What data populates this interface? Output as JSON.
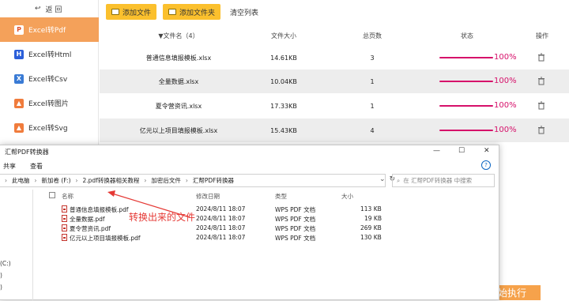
{
  "app": {
    "back_label": "返 回",
    "sidebar": [
      {
        "label": "Excel转Pdf",
        "icon": "pdf-icon",
        "color": "#e0502c",
        "active": true
      },
      {
        "label": "Excel转Html",
        "icon": "html-icon",
        "color": "#2b5fd9",
        "active": false
      },
      {
        "label": "Excel转Csv",
        "icon": "csv-icon",
        "color": "#3a7bd5",
        "active": false
      },
      {
        "label": "Excel转图片",
        "icon": "image-icon",
        "color": "#f07c3c",
        "active": false
      },
      {
        "label": "Excel转Svg",
        "icon": "svg-icon",
        "color": "#f07c3c",
        "active": false
      }
    ],
    "toolbar": {
      "add_file": "添加文件",
      "add_folder": "添加文件夹",
      "clear_list": "清空列表"
    },
    "table": {
      "headers": {
        "name": "▼文件名（4）",
        "size": "文件大小",
        "pages": "总页数",
        "status": "状态",
        "action": "操作"
      },
      "rows": [
        {
          "name": "普通信息填报模板.xlsx",
          "size": "14.61KB",
          "pages": "3",
          "progress": "100%"
        },
        {
          "name": "全量数据.xlsx",
          "size": "10.04KB",
          "pages": "1",
          "progress": "100%"
        },
        {
          "name": "夏令营资讯.xlsx",
          "size": "17.33KB",
          "pages": "1",
          "progress": "100%"
        },
        {
          "name": "亿元以上项目填报模板.xlsx",
          "size": "15.43KB",
          "pages": "4",
          "progress": "100%"
        }
      ]
    },
    "start_button": "始执行",
    "accent_color": "#f4a15a",
    "progress_color": "#d6106a"
  },
  "explorer": {
    "title": "汇帮PDF转换器",
    "ribbon": [
      "共享",
      "查看"
    ],
    "breadcrumb": [
      "此电脑",
      "新加卷 (F:)",
      "2.pdf转换器相关教程",
      "加密后文件",
      "汇帮PDF转换器"
    ],
    "search_placeholder": "在 汇帮PDF转换器 中搜索",
    "nav_fragments": [
      "(C:)",
      ")",
      ")"
    ],
    "columns": {
      "name": "名称",
      "modified": "修改日期",
      "type": "类型",
      "size": "大小"
    },
    "files": [
      {
        "name": "普通信息填报模板.pdf",
        "modified": "2024/8/11 18:07",
        "type": "WPS PDF 文档",
        "size": "113 KB"
      },
      {
        "name": "全量数据.pdf",
        "modified": "2024/8/11 18:07",
        "type": "WPS PDF 文档",
        "size": "19 KB"
      },
      {
        "name": "夏令营资讯.pdf",
        "modified": "2024/8/11 18:07",
        "type": "WPS PDF 文档",
        "size": "269 KB"
      },
      {
        "name": "亿元以上项目填报模板.pdf",
        "modified": "2024/8/11 18:07",
        "type": "WPS PDF 文档",
        "size": "130 KB"
      }
    ],
    "annotation": "转换出来的文件"
  }
}
